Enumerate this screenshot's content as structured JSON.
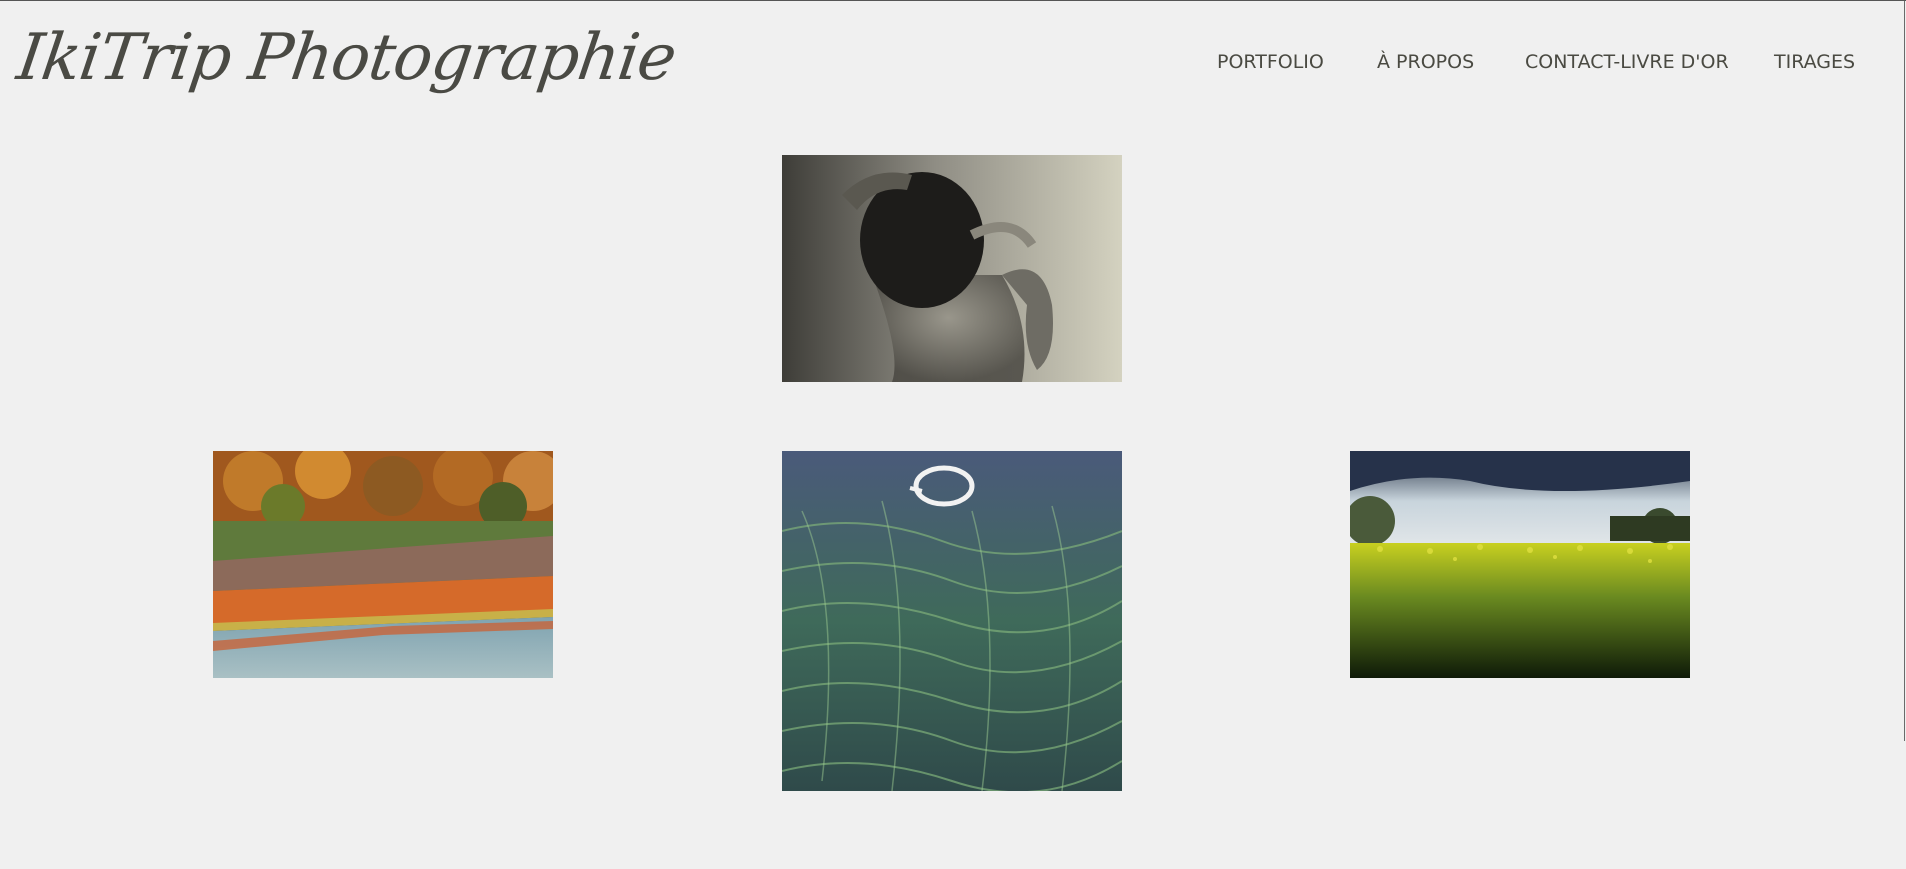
{
  "site": {
    "logo_text": "IkiTrip Photographie"
  },
  "nav": {
    "items": [
      {
        "label": "PORTFOLIO"
      },
      {
        "label": "À PROPOS"
      },
      {
        "label": "CONTACT-LIVRE D'OR"
      },
      {
        "label": "TIRAGES"
      }
    ]
  },
  "gallery": {
    "photos": [
      {
        "subject": "black-and-white portrait of woman"
      },
      {
        "subject": "autumn riverbank landscape"
      },
      {
        "subject": "green water plants with ring"
      },
      {
        "subject": "rapeseed field under stormy sky"
      }
    ]
  },
  "colors": {
    "background": "#f0f0f0",
    "text": "#4a4a42"
  }
}
